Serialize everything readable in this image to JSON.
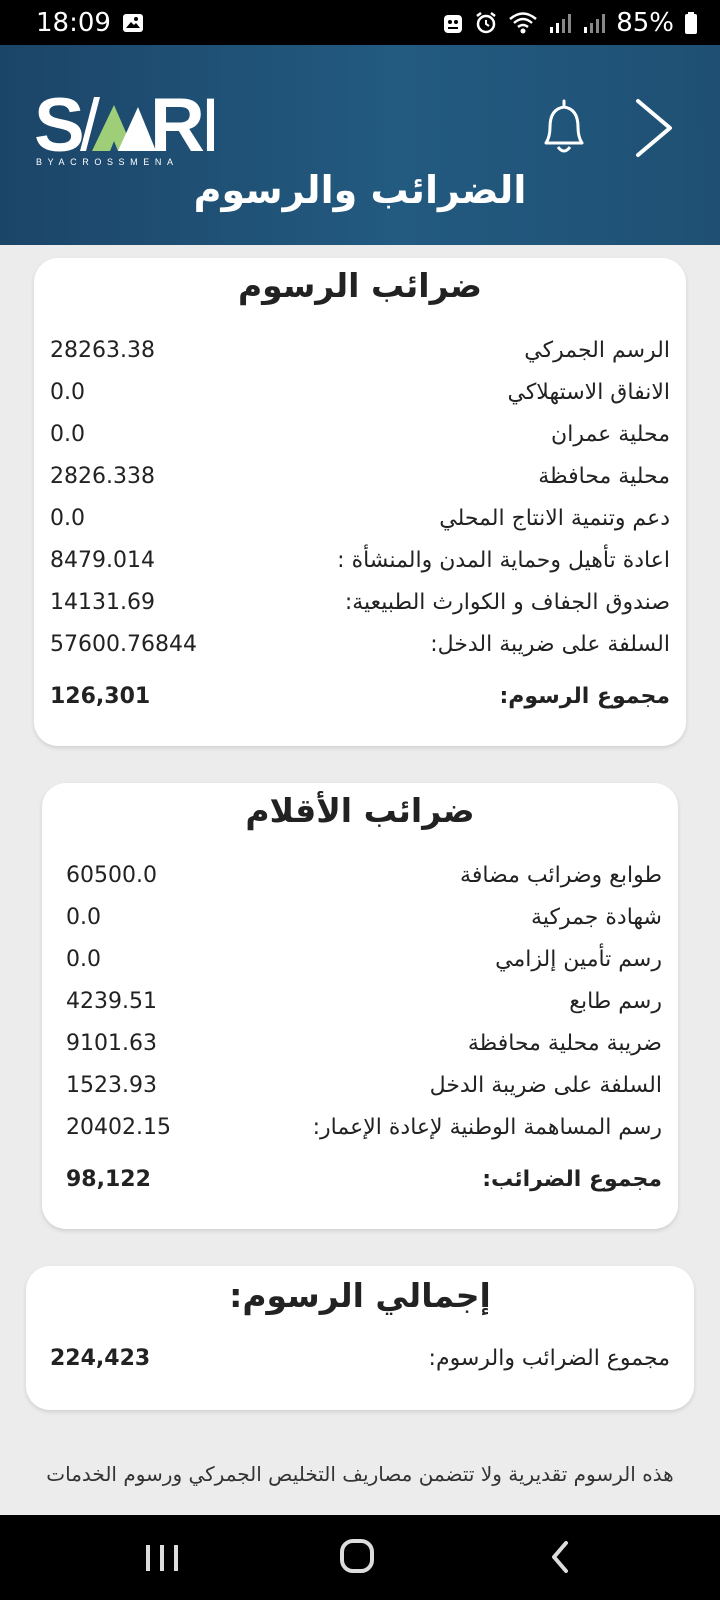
{
  "status": {
    "time": "18:09",
    "battery": "85%"
  },
  "header": {
    "logo_text": "SARI",
    "logo_sub": "BYACROSSMENA",
    "title": "الضرائب والرسوم"
  },
  "fees": {
    "title": "ضرائب الرسوم",
    "rows": [
      {
        "label": "الرسم الجمركي",
        "value": "28263.38"
      },
      {
        "label": "الانفاق الاستهلاكي",
        "value": "0.0"
      },
      {
        "label": "محلية عمران",
        "value": "0.0"
      },
      {
        "label": "محلية محافظة",
        "value": "2826.338"
      },
      {
        "label": "دعم وتنمية الانتاج المحلي",
        "value": "0.0"
      },
      {
        "label": "اعادة تأهيل وحماية المدن والمنشأة :",
        "value": "8479.014"
      },
      {
        "label": "صندوق الجفاف و الكوارث الطبيعية:",
        "value": "14131.69"
      },
      {
        "label": "السلفة على ضريبة الدخل:",
        "value": "57600.76844"
      }
    ],
    "total_label": "مجموع الرسوم:",
    "total_value": "126,301"
  },
  "items": {
    "title": "ضرائب الأقلام",
    "rows": [
      {
        "label": "طوابع وضرائب مضافة",
        "value": "60500.0"
      },
      {
        "label": "شهادة جمركية",
        "value": "0.0"
      },
      {
        "label": "رسم تأمين إلزامي",
        "value": "0.0"
      },
      {
        "label": "رسم طابع",
        "value": "4239.51"
      },
      {
        "label": "ضريبة محلية محافظة",
        "value": "9101.63"
      },
      {
        "label": "السلفة على ضريبة الدخل",
        "value": "1523.93"
      },
      {
        "label": "رسم المساهمة الوطنية لإعادة الإعمار:",
        "value": "20402.15"
      }
    ],
    "total_label": "مجموع الضرائب:",
    "total_value": "98,122"
  },
  "grand": {
    "title": "إجمالي الرسوم:",
    "label": "مجموع الضرائب والرسوم:",
    "value": "224,423"
  },
  "footer_note": "هذه الرسوم تقديرية ولا تتضمن مصاريف التخليص الجمركي ورسوم الخدمات",
  "colors": {
    "header_bg": "#1f5074",
    "logo_accent": "#9ecf78",
    "page_bg": "#ececec"
  }
}
